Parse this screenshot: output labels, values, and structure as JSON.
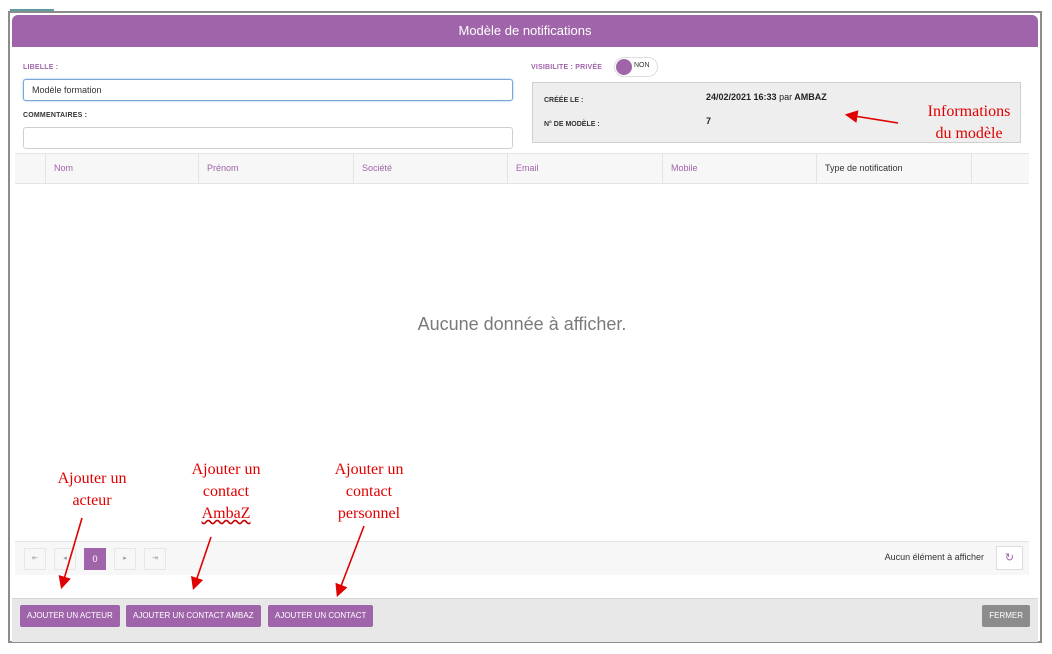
{
  "window": {
    "title": "Modèle de notifications"
  },
  "form": {
    "libelle_label": "LIBELLE :",
    "libelle_value": "Modèle formation",
    "commentaires_label": "COMMENTAIRES :",
    "commentaires_value": "",
    "visibilite_label": "VISIBILITE : PRIVÉE",
    "visibilite_toggle": "NON"
  },
  "info": {
    "cree_label": "CRÉÉE LE :",
    "cree_date": "24/02/2021 16:33",
    "cree_par": "par",
    "cree_user": "AMBAZ",
    "numero_label": "N° DE MODÈLE :",
    "numero_value": "7"
  },
  "table": {
    "columns": [
      "Nom",
      "Prénom",
      "Société",
      "Email",
      "Mobile",
      "Type de notification"
    ],
    "rows": [],
    "empty_message": "Aucune donnée à afficher."
  },
  "pager": {
    "current_page": "0",
    "first_icon": "first-page-icon",
    "prev_icon": "prev-page-icon",
    "next_icon": "next-page-icon",
    "last_icon": "last-page-icon",
    "info": "Aucun élément à afficher",
    "refresh_icon": "refresh-icon"
  },
  "footer": {
    "add_actor": "AJOUTER UN ACTEUR",
    "add_ambaz_contact": "AJOUTER UN CONTACT AMBAZ",
    "add_contact": "AJOUTER UN CONTACT",
    "close": "FERMER"
  },
  "annotations": {
    "info_line1": "Informations",
    "info_line2": "du modèle",
    "actor_line1": "Ajouter un",
    "actor_line2": "acteur",
    "ambaz_line1": "Ajouter un",
    "ambaz_line2": "contact",
    "ambaz_line3": "AmbaZ",
    "perso_line1": "Ajouter un",
    "perso_line2": "contact",
    "perso_line3": "personnel"
  },
  "colors": {
    "accent": "#a064aa",
    "annotation": "#e00000",
    "close_button": "#8c8c8c"
  }
}
